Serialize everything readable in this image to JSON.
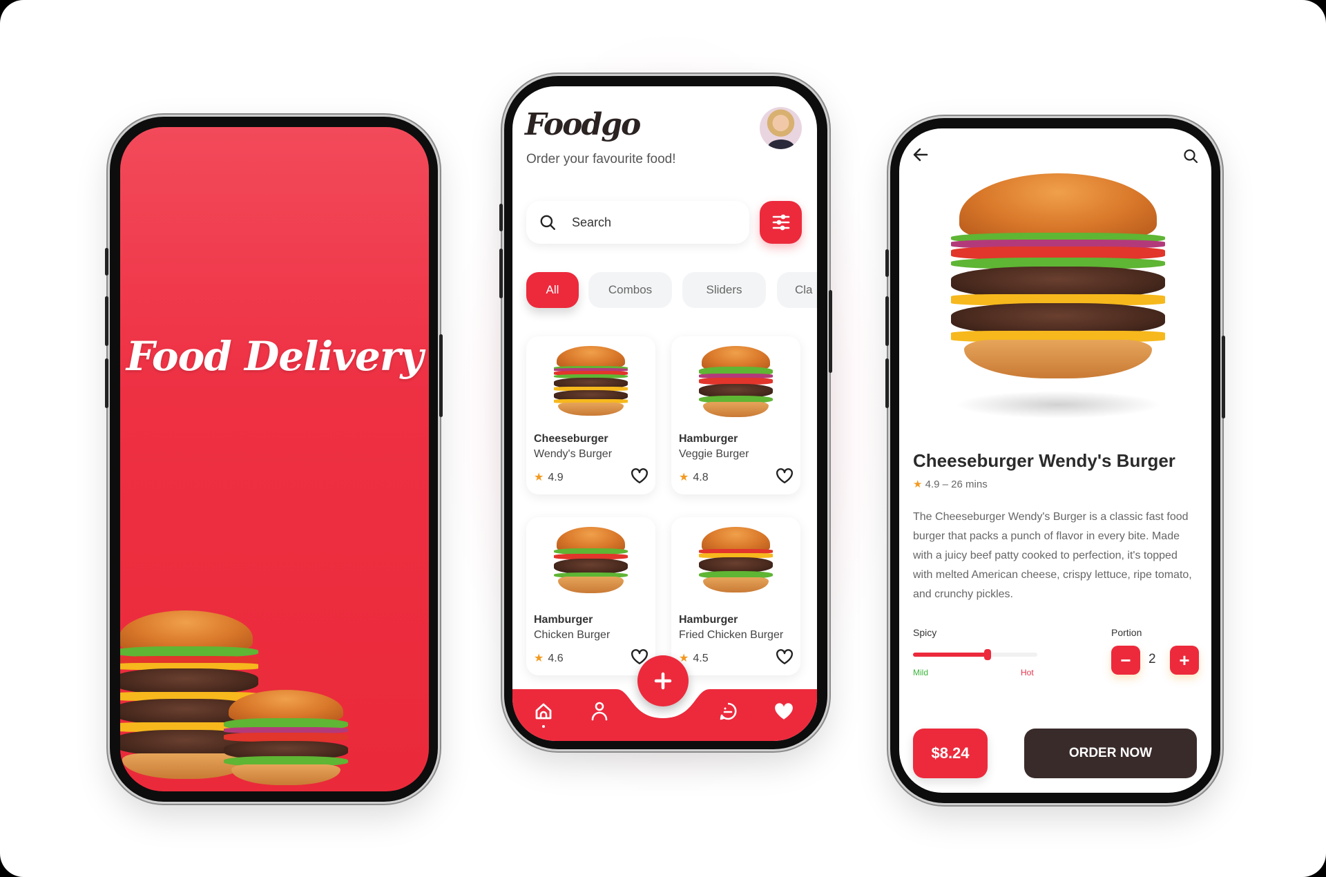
{
  "colors": {
    "accent": "#ec2a3c",
    "dark_button": "#3a2b2b",
    "star": "#f39a21",
    "mild": "#3ab53a",
    "hot": "#e2334a"
  },
  "splash": {
    "title": "Food Delivery"
  },
  "home": {
    "brand": "Foodgo",
    "tagline": "Order your favourite food!",
    "search": {
      "placeholder": "Search",
      "icon": "search-icon"
    },
    "filter_icon": "sliders-icon",
    "chips": [
      {
        "label": "All",
        "active": true
      },
      {
        "label": "Combos"
      },
      {
        "label": "Sliders"
      },
      {
        "label": "Cla"
      }
    ],
    "cards": [
      {
        "name": "Cheeseburger",
        "sub": "Wendy's Burger",
        "rating": "4.9"
      },
      {
        "name": "Hamburger",
        "sub": "Veggie Burger",
        "rating": "4.8"
      },
      {
        "name": "Hamburger",
        "sub": "Chicken Burger",
        "rating": "4.6"
      },
      {
        "name": "Hamburger",
        "sub": "Fried Chicken Burger",
        "rating": "4.5"
      }
    ],
    "nav": [
      "home-icon",
      "profile-icon",
      "chat-icon",
      "heart-icon"
    ],
    "fab_icon": "plus-icon"
  },
  "detail": {
    "title": "Cheeseburger Wendy's Burger",
    "rating": "4.9",
    "time": "– 26 mins",
    "description": "The Cheeseburger Wendy's Burger is a classic fast food burger that packs a punch of flavor in every bite. Made with a juicy beef patty cooked to perfection, it's topped with melted American cheese, crispy lettuce, ripe tomato, and crunchy pickles.",
    "spicy": {
      "label": "Spicy",
      "min_label": "Mild",
      "max_label": "Hot",
      "value": 0.6
    },
    "portion": {
      "label": "Portion",
      "value": "2",
      "minus": "−",
      "plus": "+"
    },
    "price": "$8.24",
    "order_label": "ORDER NOW"
  }
}
